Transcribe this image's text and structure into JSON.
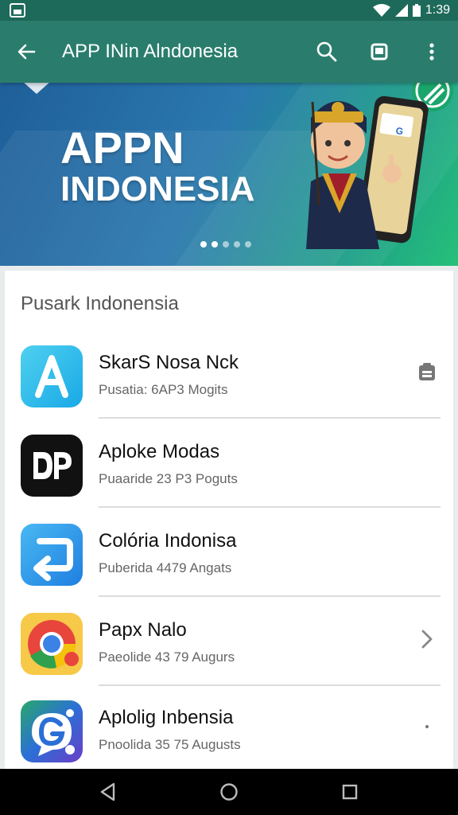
{
  "status_bar": {
    "time": "1:39"
  },
  "app_bar": {
    "title": "APP INin Alndonesia"
  },
  "banner": {
    "headline_line1": "APPN",
    "headline_line2": "INDONESIA",
    "phone_label": "G"
  },
  "section": {
    "title": "Pusark Indonensia",
    "apps": [
      {
        "name": "SkarS Nosa Nck",
        "sub": "Pusatia: 6AP3 Mogits",
        "icon": "a-letter-icon",
        "trailing": "clipboard-icon"
      },
      {
        "name": "Aploke Modas",
        "sub": "Puaaride 23 P3 Poguts",
        "icon": "dp-logo-icon",
        "trailing": ""
      },
      {
        "name": "Colória Indonisa",
        "sub": "Puberida 4479 Angats",
        "icon": "swap-arrow-icon",
        "trailing": ""
      },
      {
        "name": "Papx Nalo",
        "sub": "Paeolide 43 79 Augurs",
        "icon": "chrome-like-icon",
        "trailing": "chevron-right-icon"
      },
      {
        "name": "Aplolig Inbensia",
        "sub": "Pnoolida 35 75 Augusts",
        "icon": "g-chat-icon",
        "trailing": "dot-icon"
      }
    ]
  },
  "colors": {
    "status_bar": "#1e6a5a",
    "app_bar": "#2a7d6c",
    "banner_start": "#1f5f9a",
    "banner_end": "#26c07a"
  }
}
